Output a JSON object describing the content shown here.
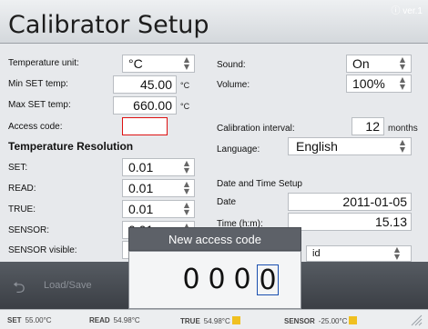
{
  "title": "Calibrator Setup",
  "corner_label": "ⓘ ver.1",
  "left": {
    "temp_unit": {
      "label": "Temperature unit:",
      "value": "°C"
    },
    "min_set": {
      "label": "Min SET temp:",
      "value": "45.00",
      "unit": "°C"
    },
    "max_set": {
      "label": "Max SET temp:",
      "value": "660.00",
      "unit": "°C"
    },
    "access_code": {
      "label": "Access code:",
      "value": ""
    },
    "resolution_title": "Temperature Resolution",
    "set": {
      "label": "SET:",
      "value": "0.01"
    },
    "read": {
      "label": "READ:",
      "value": "0.01"
    },
    "true": {
      "label": "TRUE:",
      "value": "0.01"
    },
    "sensor": {
      "label": "SENSOR:",
      "value": "0.01"
    },
    "sensor_visible": {
      "label": "SENSOR visible:"
    }
  },
  "right": {
    "sound": {
      "label": "Sound:",
      "value": "On"
    },
    "volume": {
      "label": "Volume:",
      "value": "100%"
    },
    "cal_interval": {
      "label": "Calibration interval:",
      "value": "12",
      "unit": "months"
    },
    "language": {
      "label": "Language:",
      "value": "English"
    },
    "datetime_title": "Date and Time Setup",
    "date": {
      "label": "Date",
      "value": "2011-01-05"
    },
    "time": {
      "label": "Time (h:m):",
      "value": "15.13"
    },
    "dropdown_partial": "id"
  },
  "bottom": {
    "load_save": "Load/Save"
  },
  "popup": {
    "title": "New access code",
    "digits": [
      "0",
      "0",
      "0",
      "0"
    ]
  },
  "status": {
    "set_label": "SET",
    "set_value": "55.00°C",
    "read_label": "READ",
    "read_value": "54.98°C",
    "true_label": "TRUE",
    "true_value": "54.98°C",
    "sensor_label": "SENSOR",
    "sensor_value": "-25.00°C"
  }
}
